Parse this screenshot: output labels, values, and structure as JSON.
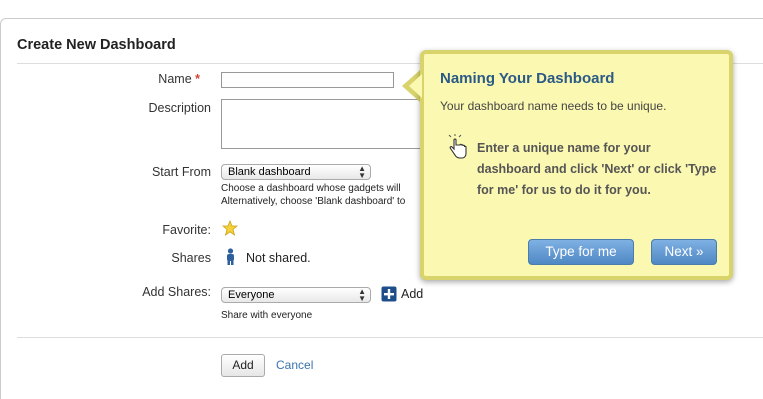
{
  "form": {
    "title": "Create New Dashboard",
    "name_label": "Name",
    "required_mark": "*",
    "name_value": "",
    "description_label": "Description",
    "description_value": "",
    "start_from_label": "Start From",
    "start_from_selected": "Blank dashboard",
    "start_from_hint_1": "Choose a dashboard whose gadgets will",
    "start_from_hint_2": "Alternatively, choose 'Blank dashboard' to",
    "favorite_label": "Favorite:",
    "shares_label": "Shares",
    "shares_value": "Not shared.",
    "add_shares_label": "Add Shares:",
    "add_shares_selected": "Everyone",
    "add_link": "Add",
    "add_shares_hint": "Share with everyone",
    "add_button": "Add",
    "cancel_link": "Cancel"
  },
  "tooltip": {
    "title": "Naming Your Dashboard",
    "subtitle": "Your dashboard name needs to be unique.",
    "body": "Enter a unique name for your dashboard and click 'Next' or click 'Type for me' for us to do it for you.",
    "type_for_me": "Type for me",
    "next": "Next »"
  },
  "icons": {
    "favorite": "star-icon",
    "shares": "user-icon",
    "add": "plus-icon",
    "pointer": "hand-pointer-icon",
    "select_arrow": "up-down-arrows-icon"
  },
  "colors": {
    "tooltip_bg": "#fbf8b2",
    "tooltip_border": "#d8d36b",
    "tooltip_title": "#2b5a86",
    "button_blue": "#4f88c4",
    "link": "#3b73af",
    "required": "#d04437"
  }
}
